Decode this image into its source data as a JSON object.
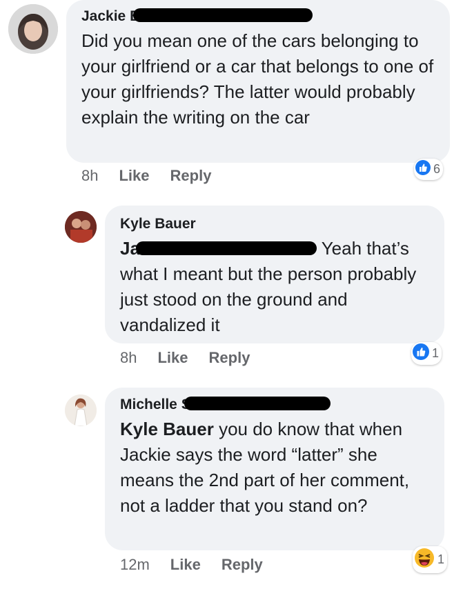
{
  "comments": [
    {
      "author": "Jackie B",
      "text": "Did you mean one of the cars belonging to your girlfriend or a car that belongs to one of your girlfriends? The latter would probably explain the writing on the car",
      "time": "8h",
      "like_label": "Like",
      "reply_label": "Reply",
      "reaction_count": "6",
      "reaction_icon": "like-icon"
    },
    {
      "author": "Kyle Bauer",
      "mention": "Ja",
      "text": "Yeah that’s what I meant but the person probably just stood on the ground and vandalized it",
      "time": "8h",
      "like_label": "Like",
      "reply_label": "Reply",
      "reaction_count": "1",
      "reaction_icon": "like-icon"
    },
    {
      "author": "Michelle S",
      "mention": "Kyle Bauer",
      "text": "you do know that when Jackie says the word “latter” she means the 2nd part of her comment, not a ladder that you stand on?",
      "time": "12m",
      "like_label": "Like",
      "reply_label": "Reply",
      "reaction_count": "1",
      "reaction_icon": "laugh-icon"
    }
  ],
  "colors": {
    "bubble": "#f0f2f5",
    "meta": "#65676b",
    "like_blue": "#1877f2",
    "laugh_yellow": "#f7b928"
  }
}
